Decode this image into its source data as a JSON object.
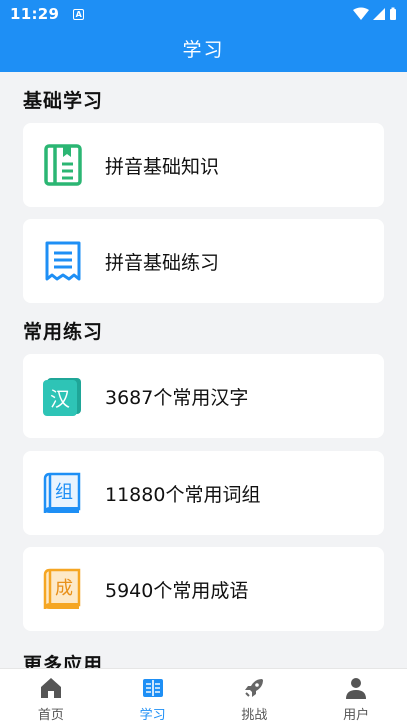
{
  "statusbar": {
    "time": "11:29",
    "indicator": "A"
  },
  "header": {
    "title": "学习"
  },
  "sections": {
    "basic": {
      "title": "基础学习"
    },
    "common": {
      "title": "常用练习"
    },
    "more": {
      "title": "更多应用"
    }
  },
  "cards": {
    "pinyin_knowledge": {
      "label": "拼音基础知识",
      "icon": "notebook-icon",
      "color": "#2bb673"
    },
    "pinyin_practice": {
      "label": "拼音基础练习",
      "icon": "receipt-list-icon",
      "color": "#1e8ff5"
    },
    "hanzi": {
      "label": "3687个常用汉字",
      "icon_text": "汉",
      "color": "#2ec4b6"
    },
    "ciyu": {
      "label": "11880个常用词组",
      "icon_text": "组",
      "color": "#1e8ff5"
    },
    "chengyu": {
      "label": "5940个常用成语",
      "icon_text": "成",
      "color": "#f5a623"
    }
  },
  "tabs": [
    {
      "label": "首页",
      "icon": "home-icon"
    },
    {
      "label": "学习",
      "icon": "book-icon"
    },
    {
      "label": "挑战",
      "icon": "rocket-icon"
    },
    {
      "label": "用户",
      "icon": "user-icon"
    }
  ],
  "colors": {
    "primary": "#1e8ff5",
    "background": "#f2f3f5"
  }
}
